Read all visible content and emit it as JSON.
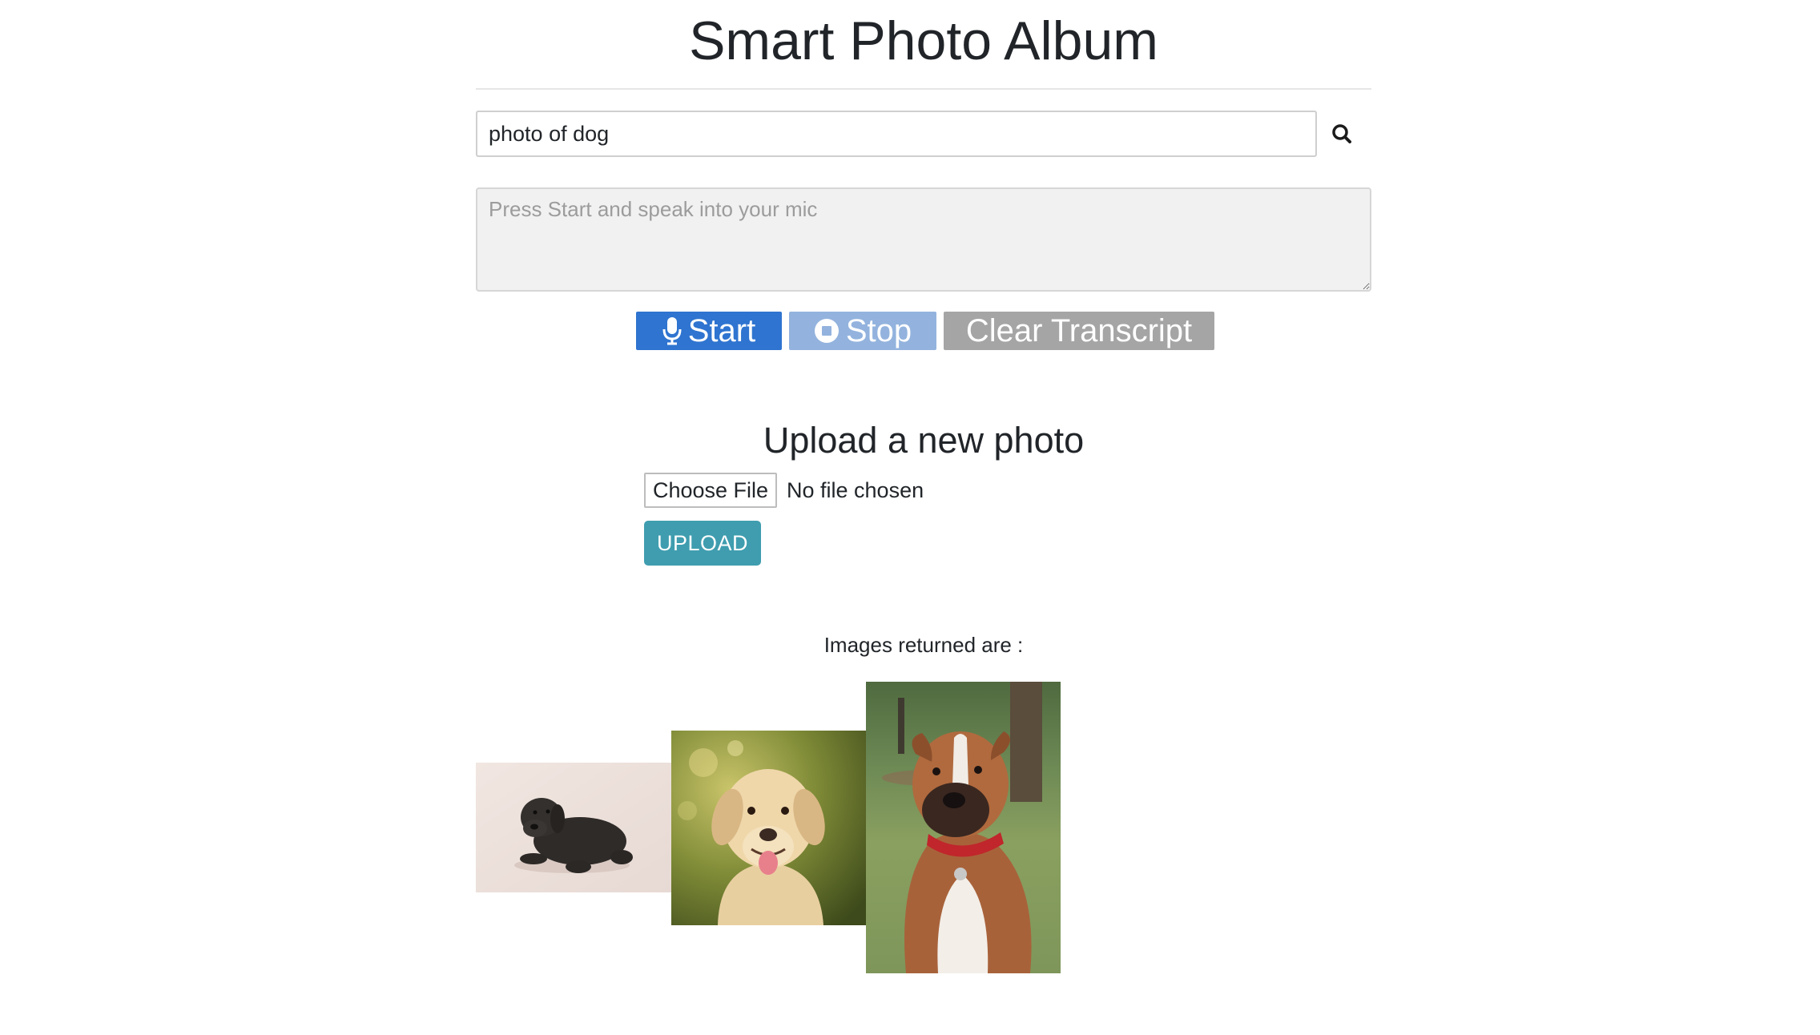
{
  "header": {
    "title": "Smart Photo Album"
  },
  "search": {
    "value": "photo of dog",
    "icon": "search-icon"
  },
  "transcript": {
    "placeholder": "Press Start and speak into your mic",
    "value": ""
  },
  "voice_controls": {
    "start_label": "Start",
    "start_icon": "microphone-icon",
    "stop_label": "Stop",
    "stop_icon": "stop-circle-icon",
    "clear_label": "Clear Transcript"
  },
  "upload": {
    "heading": "Upload a new photo",
    "choose_file_label": "Choose File",
    "file_status": "No file chosen",
    "upload_button_label": "UPLOAD"
  },
  "results": {
    "label": "Images returned are :",
    "images": [
      {
        "subject": "black labrador lying down"
      },
      {
        "subject": "yellow labrador smiling"
      },
      {
        "subject": "boxer with red collar"
      }
    ]
  },
  "colors": {
    "start_button": "#2f74d0",
    "stop_button": "#93b3de",
    "clear_button": "#a5a5a5",
    "upload_button": "#3f9daf",
    "transcript_bg": "#f1f1f1"
  }
}
